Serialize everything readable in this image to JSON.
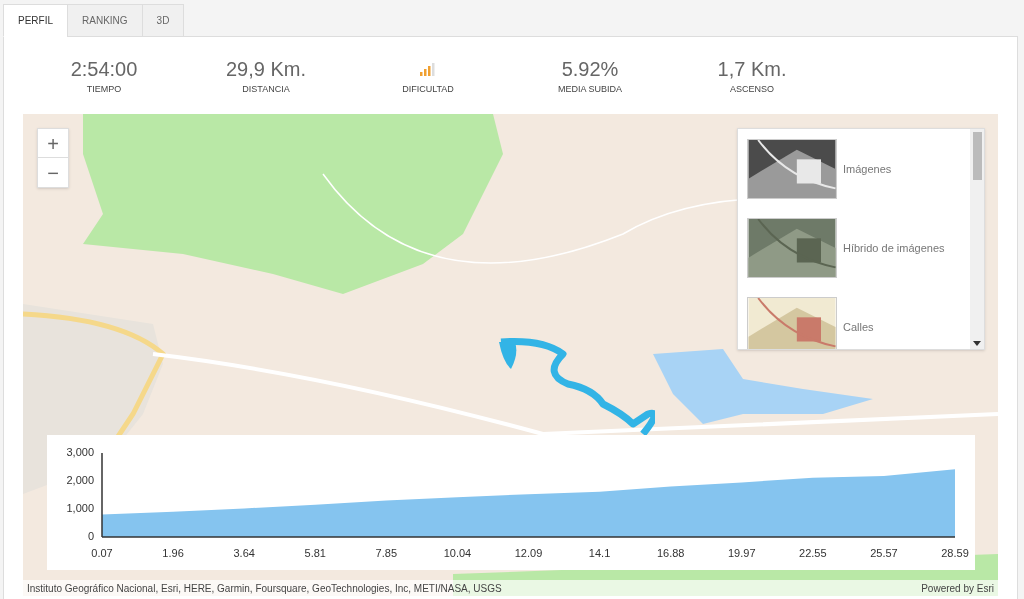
{
  "tabs": [
    {
      "label": "PERFIL",
      "selected": true
    },
    {
      "label": "RANKING",
      "selected": false
    },
    {
      "label": "3D",
      "selected": false
    }
  ],
  "stats": [
    {
      "kind": "text",
      "value": "2:54:00",
      "label": "TIEMPO"
    },
    {
      "kind": "text",
      "value": "29,9 Km.",
      "label": "DISTANCIA"
    },
    {
      "kind": "meter",
      "level": 0.75,
      "label": "DIFICULTAD"
    },
    {
      "kind": "text",
      "value": "5.92%",
      "label": "MEDIA SUBIDA"
    },
    {
      "kind": "text",
      "value": "1,7 Km.",
      "label": "ASCENSO"
    }
  ],
  "map": {
    "zoom_in": "+",
    "zoom_out": "−",
    "basemaps": [
      {
        "label": "Imágenes",
        "kind": "imagery"
      },
      {
        "label": "Híbrido de imágenes",
        "kind": "hybrid"
      },
      {
        "label": "Calles",
        "kind": "streets"
      }
    ],
    "attribution": "Instituto Geográfico Nacional, Esri, HERE, Garmin, Foursquare, GeoTechnologies, Inc, METI/NASA, USGS",
    "powered_by": "Powered by Esri"
  },
  "profile": {
    "chart_data": {
      "type": "area",
      "categories": [
        "0.07",
        "1.96",
        "3.64",
        "5.81",
        "7.85",
        "10.04",
        "12.09",
        "14.1",
        "16.88",
        "19.97",
        "22.55",
        "25.57",
        "28.59"
      ],
      "series": [
        {
          "color": "#85c4ef",
          "values": [
            800,
            900,
            1020,
            1150,
            1300,
            1420,
            1530,
            1620,
            1800,
            1950,
            2120,
            2180,
            2420
          ]
        }
      ],
      "ylim": [
        0,
        3000
      ],
      "yticks": [
        {
          "value": 0,
          "label": "0"
        },
        {
          "value": 1000,
          "label": "1,000"
        },
        {
          "value": 2000,
          "label": "2,000"
        },
        {
          "value": 3000,
          "label": "3,000"
        }
      ]
    }
  }
}
